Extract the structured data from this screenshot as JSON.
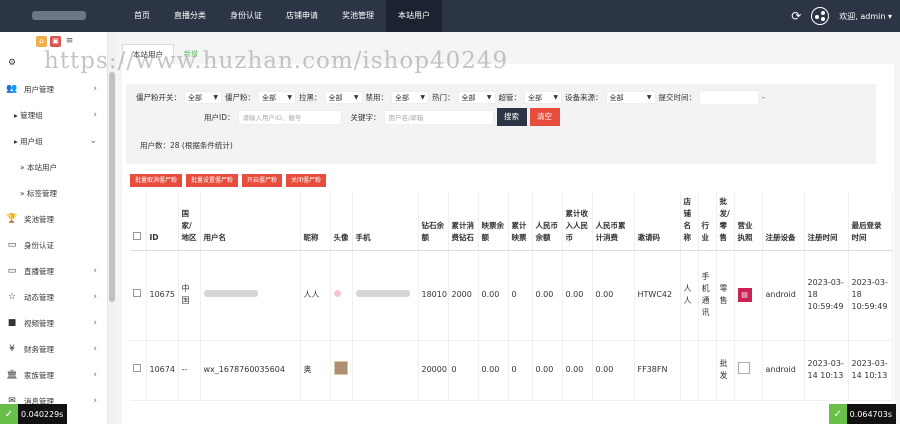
{
  "header": {
    "nav": [
      "首页",
      "直播分类",
      "身份认证",
      "店铺申请",
      "奖池管理",
      "本站用户"
    ],
    "active_index": 5,
    "greeting": "欢迎, admin ▾"
  },
  "sidebar": {
    "items": [
      {
        "label": "用户管理",
        "icon": "users-icon",
        "chevron": true,
        "level": 0
      },
      {
        "label": "管理组",
        "icon": "caret-right-icon",
        "chevron": true,
        "level": 1
      },
      {
        "label": "用户组",
        "icon": "caret-right-icon",
        "chevron": true,
        "level": 1
      },
      {
        "label": "本站用户",
        "icon": "",
        "chevron": false,
        "level": 2
      },
      {
        "label": "标签管理",
        "icon": "",
        "chevron": false,
        "level": 2
      },
      {
        "label": "奖池管理",
        "icon": "trophy-icon",
        "chevron": false,
        "level": 0
      },
      {
        "label": "身份认证",
        "icon": "monitor-icon",
        "chevron": false,
        "level": 0
      },
      {
        "label": "直播管理",
        "icon": "monitor-icon",
        "chevron": true,
        "level": 0
      },
      {
        "label": "动态管理",
        "icon": "star-icon",
        "chevron": true,
        "level": 0
      },
      {
        "label": "视频管理",
        "icon": "video-icon",
        "chevron": true,
        "level": 0
      },
      {
        "label": "财务管理",
        "icon": "yen-icon",
        "chevron": true,
        "level": 0
      },
      {
        "label": "家族管理",
        "icon": "bank-icon",
        "chevron": true,
        "level": 0
      },
      {
        "label": "消息管理",
        "icon": "envelope-icon",
        "chevron": true,
        "level": 0
      }
    ]
  },
  "tabs": [
    "本站用户",
    "新增"
  ],
  "filters": {
    "row1": [
      {
        "label": "僵尸粉开关：",
        "value": "全部"
      },
      {
        "label": "僵尸粉：",
        "value": "全部"
      },
      {
        "label": "拉黑：",
        "value": "全部"
      },
      {
        "label": "禁用：",
        "value": "全部"
      },
      {
        "label": "热门：",
        "value": "全部"
      },
      {
        "label": "超管：",
        "value": "全部"
      },
      {
        "label": "设备来源：",
        "value": "全部"
      }
    ],
    "submit_time_label": "提交时间：",
    "date_sep": "-",
    "user_id_label": "用户ID：",
    "user_id_placeholder": "请输入用户ID、靓号",
    "keyword_label": "关键字：",
    "keyword_placeholder": "用户名/邮箱",
    "search_btn": "搜索",
    "clear_btn": "清空"
  },
  "user_count": "用户数：28 (根据条件统计)",
  "actions": [
    "批量取消僵尸粉",
    "批量设置僵尸粉",
    "开启僵尸粉",
    "关闭僵尸粉"
  ],
  "table": {
    "headers": [
      "",
      "ID",
      "国家/地区",
      "用户名",
      "昵称",
      "头像",
      "手机",
      "钻石余额",
      "累计消费钻石",
      "映票余额",
      "累计映票",
      "人民币余额",
      "累计收入人民币",
      "人民币累计消费",
      "邀请码",
      "店铺名称",
      "行业",
      "批发/零售",
      "营业执照",
      "注册设备",
      "注册时间",
      "最后登录时间"
    ],
    "rows": [
      {
        "id": "10675",
        "country": "中国",
        "username": "",
        "nickname": "人人",
        "phone": "",
        "diamonds": "18010",
        "spent": "2000",
        "votes": "0.00",
        "total_votes": "0",
        "rmb": "0.00",
        "rmb_income": "0.00",
        "rmb_spent": "0.00",
        "code": "HTWC42",
        "shop": "人人",
        "industry": "手机通讯",
        "trade": "零售",
        "device": "android",
        "reg_time": "2023-03-18 10:59:49",
        "last_login": "2023-03-18 10:59:49"
      },
      {
        "id": "10674",
        "country": "--",
        "username": "wx_1678760035604",
        "nickname": "奥",
        "phone": "",
        "diamonds": "20000",
        "spent": "0",
        "votes": "0.00",
        "total_votes": "0",
        "rmb": "0.00",
        "rmb_income": "0.00",
        "rmb_spent": "0.00",
        "code": "FF38FN",
        "shop": "",
        "industry": "",
        "trade": "批发",
        "device": "android",
        "reg_time": "2023-03-14 10:13",
        "last_login": "2023-03-14 10:13"
      }
    ]
  },
  "watermark": "https://www.huzhan.com/ishop40249",
  "timers": {
    "left": "0.040229s",
    "right": "0.064703s"
  }
}
